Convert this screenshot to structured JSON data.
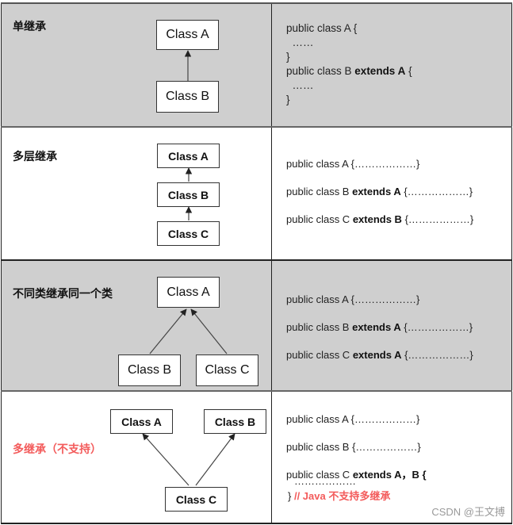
{
  "rows": [
    {
      "label": "单继承",
      "label_color": "#111111",
      "background": "#cfcfcf",
      "classes": {
        "a": "Class A",
        "b": "Class B"
      },
      "code": {
        "line1": "public class A {",
        "line2": "……",
        "line3": "}",
        "line4_prefix": "public class B ",
        "line4_keyword": "extends A",
        "line4_suffix": " {",
        "line5": "……",
        "line6": "}"
      }
    },
    {
      "label": "多层继承",
      "label_color": "#111111",
      "background": "#ffffff",
      "classes": {
        "a": "Class A",
        "b": "Class B",
        "c": "Class C"
      },
      "code": {
        "line1": "public class A {………………}",
        "line2_prefix": "public class B ",
        "line2_keyword": "extends A",
        "line2_suffix": " {………………}",
        "line3_prefix": "public class C ",
        "line3_keyword": "extends B",
        "line3_suffix": " {………………}"
      }
    },
    {
      "label": "不同类继承同一个类",
      "label_color": "#111111",
      "background": "#cfcfcf",
      "classes": {
        "a": "Class A",
        "b": "Class B",
        "c": "Class C"
      },
      "code": {
        "line1": "public class A {………………}",
        "line2_prefix": "public class B ",
        "line2_keyword": "extends A",
        "line2_suffix": " {………………}",
        "line3_prefix": "public class C ",
        "line3_keyword": "extends A",
        "line3_suffix": " {………………}"
      }
    },
    {
      "label": "多继承（不支持）",
      "label_color": "#f35b5b",
      "background": "#ffffff",
      "classes": {
        "a": "Class A",
        "b": "Class B",
        "c": "Class C"
      },
      "code": {
        "line1": "public class A {………………}",
        "line2": "public class B {………………}",
        "line3_prefix": "public class C ",
        "line3_keyword": "extends A，B {",
        "line4": "………………",
        "line5_brace": "}",
        "line5_comment": "// Java 不支持多继承"
      }
    }
  ],
  "watermark": "CSDN @王文搏"
}
